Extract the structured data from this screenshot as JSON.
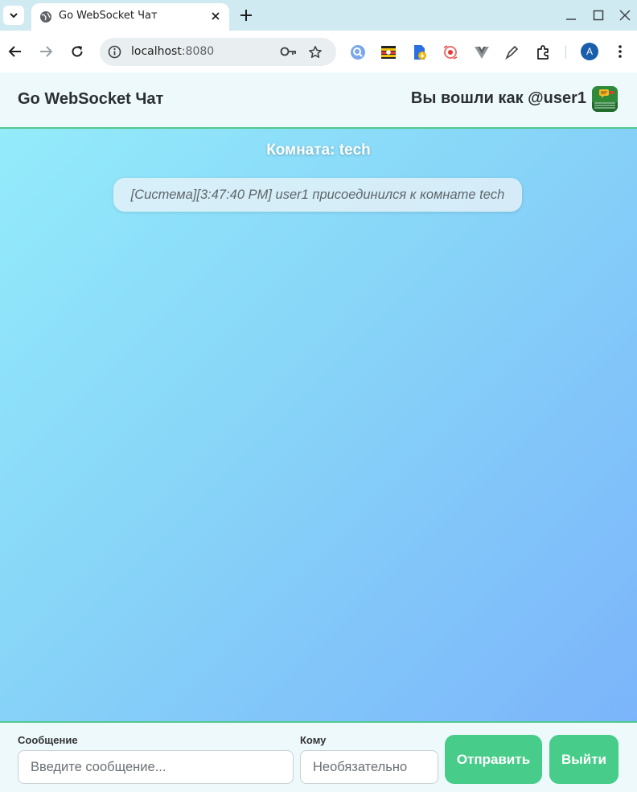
{
  "browser": {
    "tab_title": "Go WebSocket Чат",
    "url_host": "localhost",
    "url_port": ":8080",
    "profile_initial": "A",
    "icons": [
      "tab-search-icon",
      "globe-icon",
      "close-icon",
      "plus-icon",
      "minimize-icon",
      "maximize-icon",
      "close-window-icon",
      "back-icon",
      "forward-icon",
      "reload-icon",
      "site-info-icon",
      "key-icon",
      "star-icon",
      "extensions-icon",
      "kebab-menu-icon"
    ]
  },
  "header": {
    "brand": "Go WebSocket Чат",
    "user_label": "Вы вошли как @user1"
  },
  "room": {
    "title": "Комната: tech",
    "messages": [
      {
        "text": "[Система][3:47:40 PM] user1 присоединился к комнате tech"
      }
    ]
  },
  "composer": {
    "message_label": "Сообщение",
    "message_placeholder": "Введите сообщение...",
    "to_label": "Кому",
    "to_placeholder": "Необязательно",
    "send_label": "Отправить",
    "logout_label": "Выйти"
  },
  "colors": {
    "accent": "#47cd89",
    "header_bg": "#eef9fc",
    "gradient_start": "#95eefb",
    "gradient_end": "#7ab1fb"
  }
}
